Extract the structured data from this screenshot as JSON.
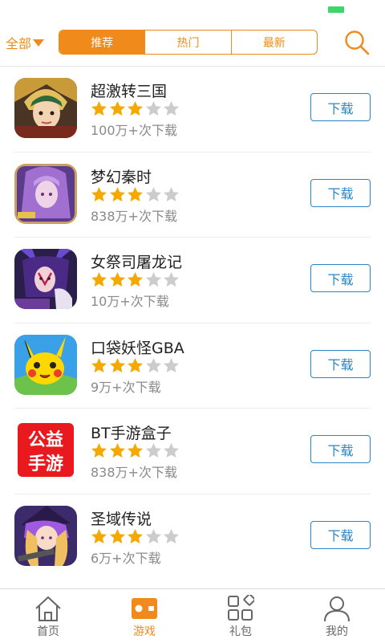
{
  "header": {
    "filter_label": "全部",
    "tabs": [
      {
        "label": "推荐",
        "active": true
      },
      {
        "label": "热门",
        "active": false
      },
      {
        "label": "最新",
        "active": false
      }
    ],
    "accent_color": "#f08a1a"
  },
  "apps": [
    {
      "name": "超激转三国",
      "rating": 3,
      "max_rating": 5,
      "downloads": "100万+次下载",
      "button": "下载",
      "icon": "three-kingdoms-warrior-icon"
    },
    {
      "name": "梦幻秦时",
      "rating": 3,
      "max_rating": 5,
      "downloads": "838万+次下载",
      "button": "下载",
      "icon": "purple-hair-heroine-icon"
    },
    {
      "name": "女祭司屠龙记",
      "rating": 3,
      "max_rating": 5,
      "downloads": "10万+次下载",
      "button": "下载",
      "icon": "priestess-icon"
    },
    {
      "name": "口袋妖怪GBA",
      "rating": 3,
      "max_rating": 5,
      "downloads": "9万+次下载",
      "button": "下载",
      "icon": "pikachu-icon"
    },
    {
      "name": "BT手游盒子",
      "rating": 3,
      "max_rating": 5,
      "downloads": "838万+次下载",
      "button": "下载",
      "icon": "public-welfare-games-icon",
      "icon_text_1": "公益",
      "icon_text_2": "手游"
    },
    {
      "name": "圣域传说",
      "rating": 3,
      "max_rating": 5,
      "downloads": "6万+次下载",
      "button": "下载",
      "icon": "witch-gunner-icon"
    }
  ],
  "bottom_nav": [
    {
      "label": "首页",
      "icon": "home-icon",
      "active": false
    },
    {
      "label": "游戏",
      "icon": "gamepad-icon",
      "active": true
    },
    {
      "label": "礼包",
      "icon": "grid-diamond-icon",
      "active": false
    },
    {
      "label": "我的",
      "icon": "person-icon",
      "active": false
    }
  ],
  "colors": {
    "accent": "#f08a1a",
    "download_button": "#2b86c8",
    "star_filled": "#f5a800",
    "star_empty": "#cccccc"
  }
}
